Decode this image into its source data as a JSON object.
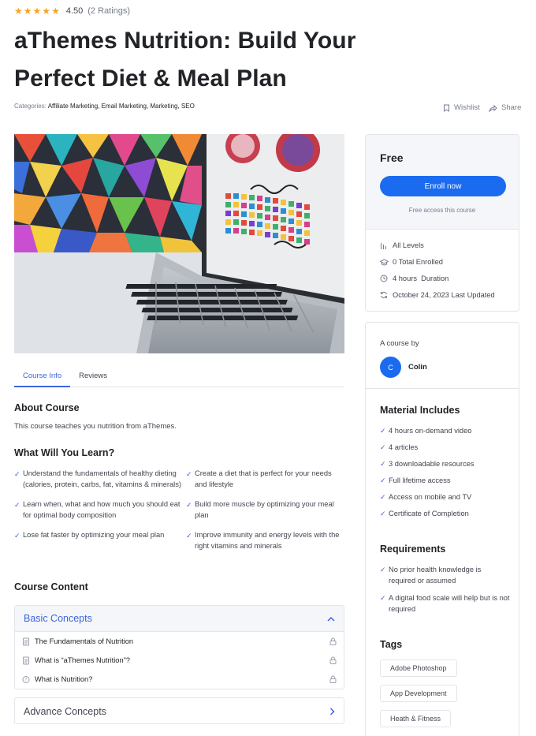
{
  "rating": {
    "value": "4.50",
    "count": "(2 Ratings)",
    "stars": 5
  },
  "course": {
    "title": "aThemes Nutrition: Build Your Perfect Diet & Meal Plan",
    "categories_label": "Categories:",
    "categories": "Affiliate Marketing, Email Marketing, Marketing, SEO"
  },
  "actions": {
    "wishlist": "Wishlist",
    "share": "Share"
  },
  "tabs": [
    {
      "label": "Course Info"
    },
    {
      "label": "Reviews"
    }
  ],
  "about": {
    "heading": "About Course",
    "text": "This course teaches you nutrition from aThemes."
  },
  "learn": {
    "heading": "What Will You Learn?",
    "items": [
      "Understand the fundamentals of healthy dieting (calories, protein, carbs, fat, vitamins & minerals)",
      "Create a diet that is perfect for your needs and lifestyle",
      "Learn when, what and how much you should eat for optimal body composition",
      "Build more muscle by optimizing your meal plan",
      "Lose fat faster by optimizing your meal plan",
      "Improve immunity and energy levels with the right vitamins and minerals"
    ]
  },
  "content": {
    "heading": "Course Content",
    "topics": [
      {
        "title": "Basic Concepts",
        "lessons": [
          {
            "title": "The Fundamentals of Nutrition",
            "icon": "document-icon"
          },
          {
            "title": "What is “aThemes Nutrition”?",
            "icon": "document-icon"
          },
          {
            "title": "What is Nutrition?",
            "icon": "quiz-icon"
          }
        ]
      },
      {
        "title": "Advance Concepts",
        "lessons": []
      }
    ]
  },
  "enroll": {
    "price": "Free",
    "button": "Enroll now",
    "note": "Free access this course",
    "meta": [
      {
        "icon": "levels-icon",
        "text": "All Levels"
      },
      {
        "icon": "graduation-cap-icon",
        "text": "0 Total Enrolled"
      },
      {
        "icon": "clock-icon",
        "text": "4 hours  Duration"
      },
      {
        "icon": "refresh-icon",
        "text": "October 24, 2023 Last Updated"
      }
    ]
  },
  "instructor": {
    "label": "A course by",
    "initial": "C",
    "name": "Colin"
  },
  "material": {
    "heading": "Material Includes",
    "items": [
      "4 hours on-demand video",
      "4 articles",
      "3 downloadable resources",
      "Full lifetime access",
      "Access on mobile and TV",
      "Certificate of Completion"
    ]
  },
  "requirements": {
    "heading": "Requirements",
    "items": [
      "No prior health knowledge is required or assumed",
      "A digital food scale will help but is not required"
    ]
  },
  "tags": {
    "heading": "Tags",
    "items": [
      "Adobe Photoshop",
      "App Development",
      "Heath & Fitness"
    ]
  },
  "colors": {
    "accent": "#3e64de",
    "button": "#1a6bf0",
    "star": "#f5a623",
    "panel": "#f4f6f9"
  }
}
